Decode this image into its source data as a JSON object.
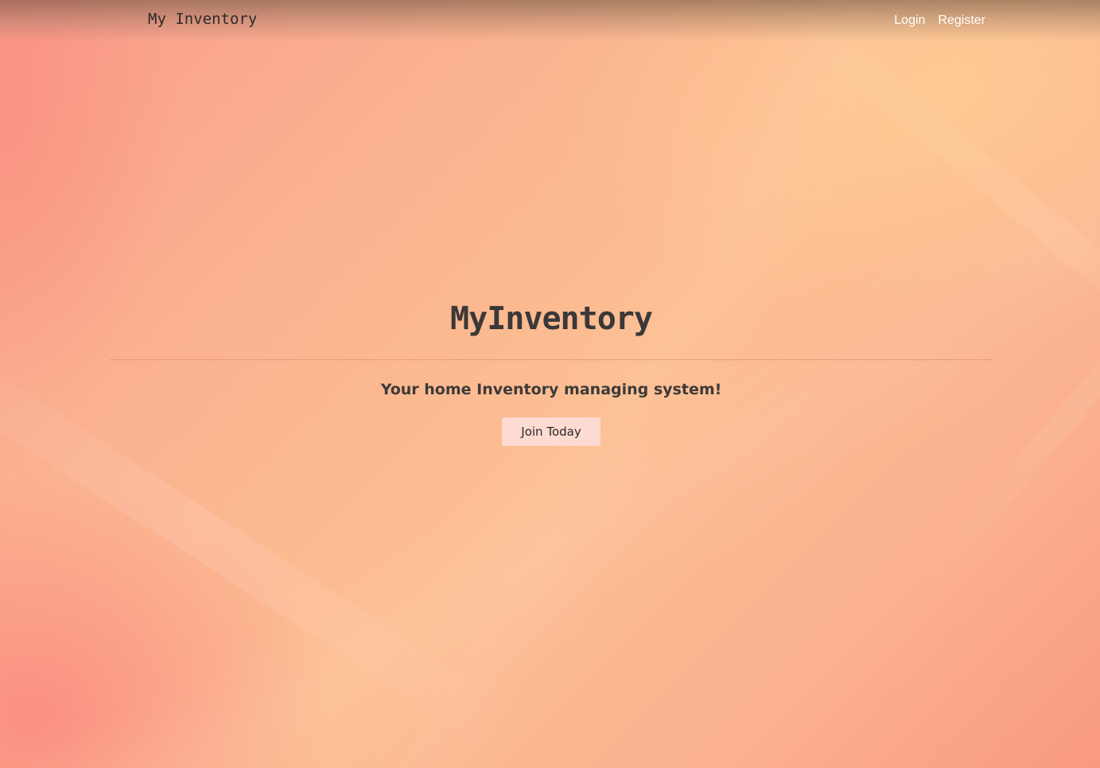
{
  "navbar": {
    "brand": "My Inventory",
    "links": [
      {
        "label": "Login"
      },
      {
        "label": "Register"
      }
    ]
  },
  "hero": {
    "title": "MyInventory",
    "subtitle": "Your home Inventory managing system!",
    "cta_label": "Join Today"
  },
  "colors": {
    "background_main": "#fbb38f",
    "background_warm_corner": "#fcc493",
    "background_pink_corner": "#f98287",
    "text_dark": "#3b3838",
    "nav_link": "#ffffff",
    "button_bg": "#fddbd2"
  }
}
